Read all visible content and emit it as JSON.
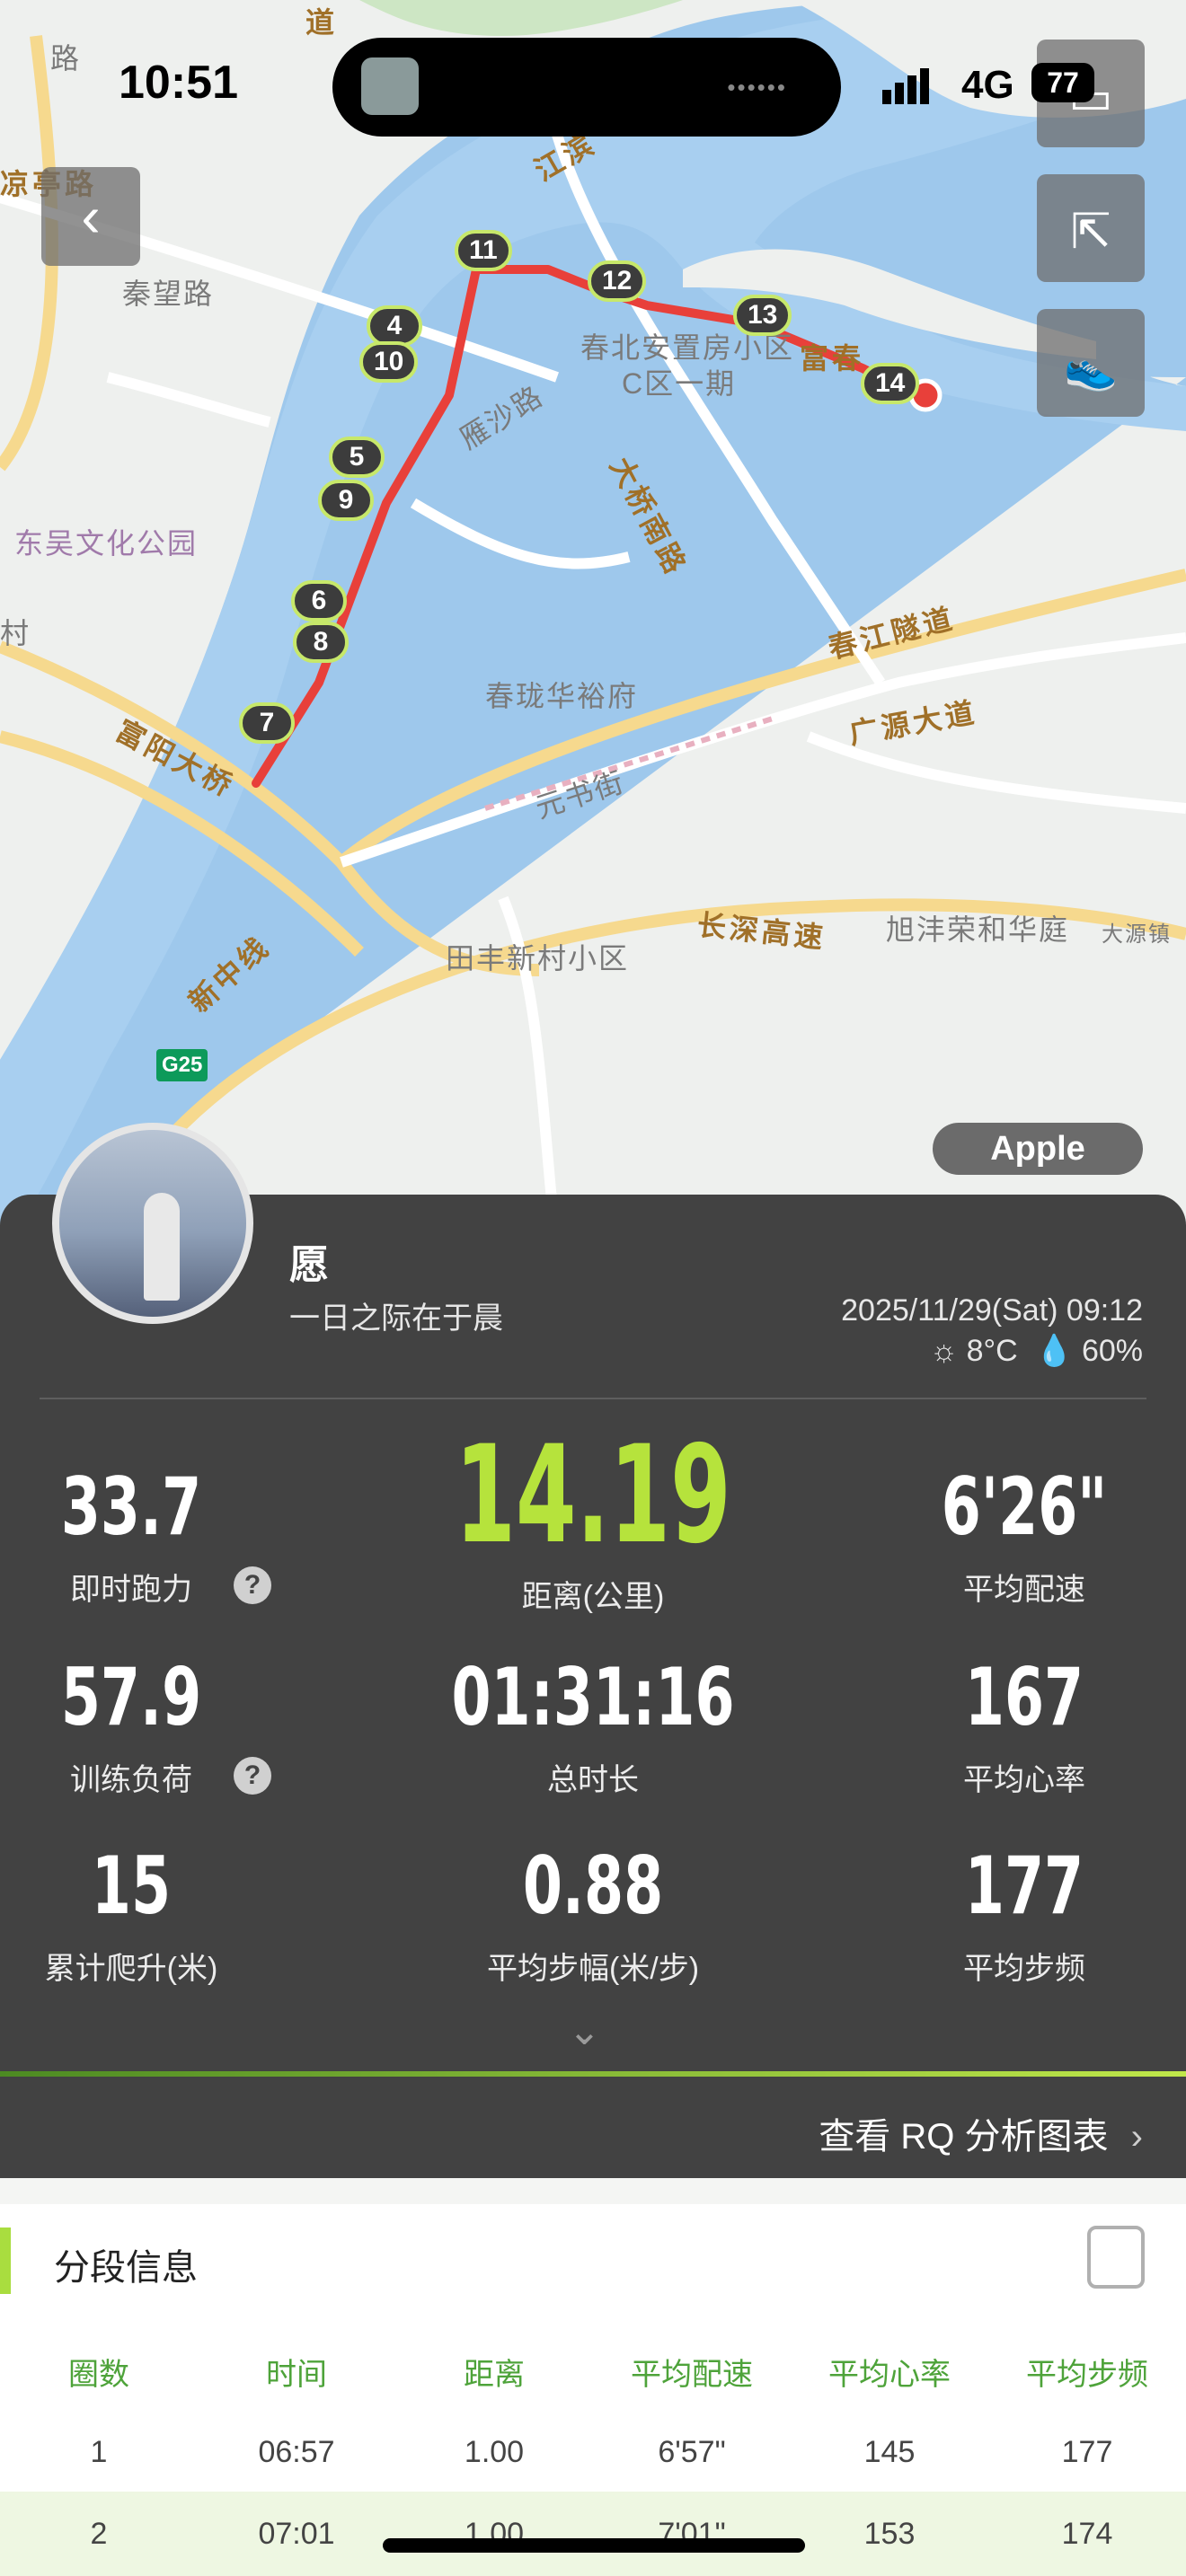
{
  "status_bar": {
    "time": "10:51",
    "network": "4G",
    "battery": "77"
  },
  "map": {
    "labels": {
      "road_jiangbin": "江滨",
      "road_qinwang": "秦望路",
      "road_liangting": "凉亭路",
      "park_dongwu": "东吴文化公园",
      "road_yansha": "雁沙路",
      "road_daqiao_south": "大桥南路",
      "poi_chunbei": "春北安置房小区",
      "poi_chunbei_sub": "C区一期",
      "road_fuchun": "富春",
      "poi_chunlong": "春珑华裕府",
      "road_chunjiang_tunnel": "春江隧道",
      "road_guangyuan": "广源大道",
      "road_yuanshu": "元书街",
      "bridge_fuyang": "富阳大桥",
      "road_xinzhong": "新中线",
      "poi_tianfeng": "田丰新村小区",
      "road_changshen": "长深高速",
      "poi_xufeng": "旭沣荣和华庭",
      "poi_dayuan": "大源镇",
      "highway_badge": "G25",
      "road_dao": "道",
      "road_lu": "路",
      "road_cun": "村"
    },
    "km_markers": [
      "4",
      "5",
      "6",
      "7",
      "8",
      "9",
      "10",
      "11",
      "12",
      "13",
      "14"
    ],
    "attribution": "Apple",
    "route_color": "#e8403a"
  },
  "profile": {
    "name": "愿",
    "bio": "一日之际在于晨",
    "datetime": "2025/11/29(Sat) 09:12",
    "temperature": "8°C",
    "humidity": "60%"
  },
  "stats": {
    "instant_power": {
      "value": "33.7",
      "label": "即时跑力"
    },
    "distance": {
      "value": "14.19",
      "label": "距离(公里)"
    },
    "avg_pace": {
      "value": "6'26\"",
      "label": "平均配速"
    },
    "training_load": {
      "value": "57.9",
      "label": "训练负荷"
    },
    "total_time": {
      "value": "01:31:16",
      "label": "总时长"
    },
    "avg_hr": {
      "value": "167",
      "label": "平均心率"
    },
    "elevation": {
      "value": "15",
      "label": "累计爬升(米)"
    },
    "stride": {
      "value": "0.88",
      "label": "平均步幅(米/步)"
    },
    "cadence": {
      "value": "177",
      "label": "平均步频"
    },
    "help_glyph": "?"
  },
  "rq_link": "查看 RQ 分析图表",
  "segments": {
    "title": "分段信息",
    "headers": [
      "圈数",
      "时间",
      "距离",
      "平均配速",
      "平均心率",
      "平均步频"
    ],
    "rows": [
      [
        "1",
        "06:57",
        "1.00",
        "6'57\"",
        "145",
        "177"
      ],
      [
        "2",
        "07:01",
        "1.00",
        "7'01\"",
        "153",
        "174"
      ]
    ]
  },
  "colors": {
    "accent_green": "#b6e33c",
    "panel_bg": "#424242",
    "header_green": "#4ea33a"
  }
}
